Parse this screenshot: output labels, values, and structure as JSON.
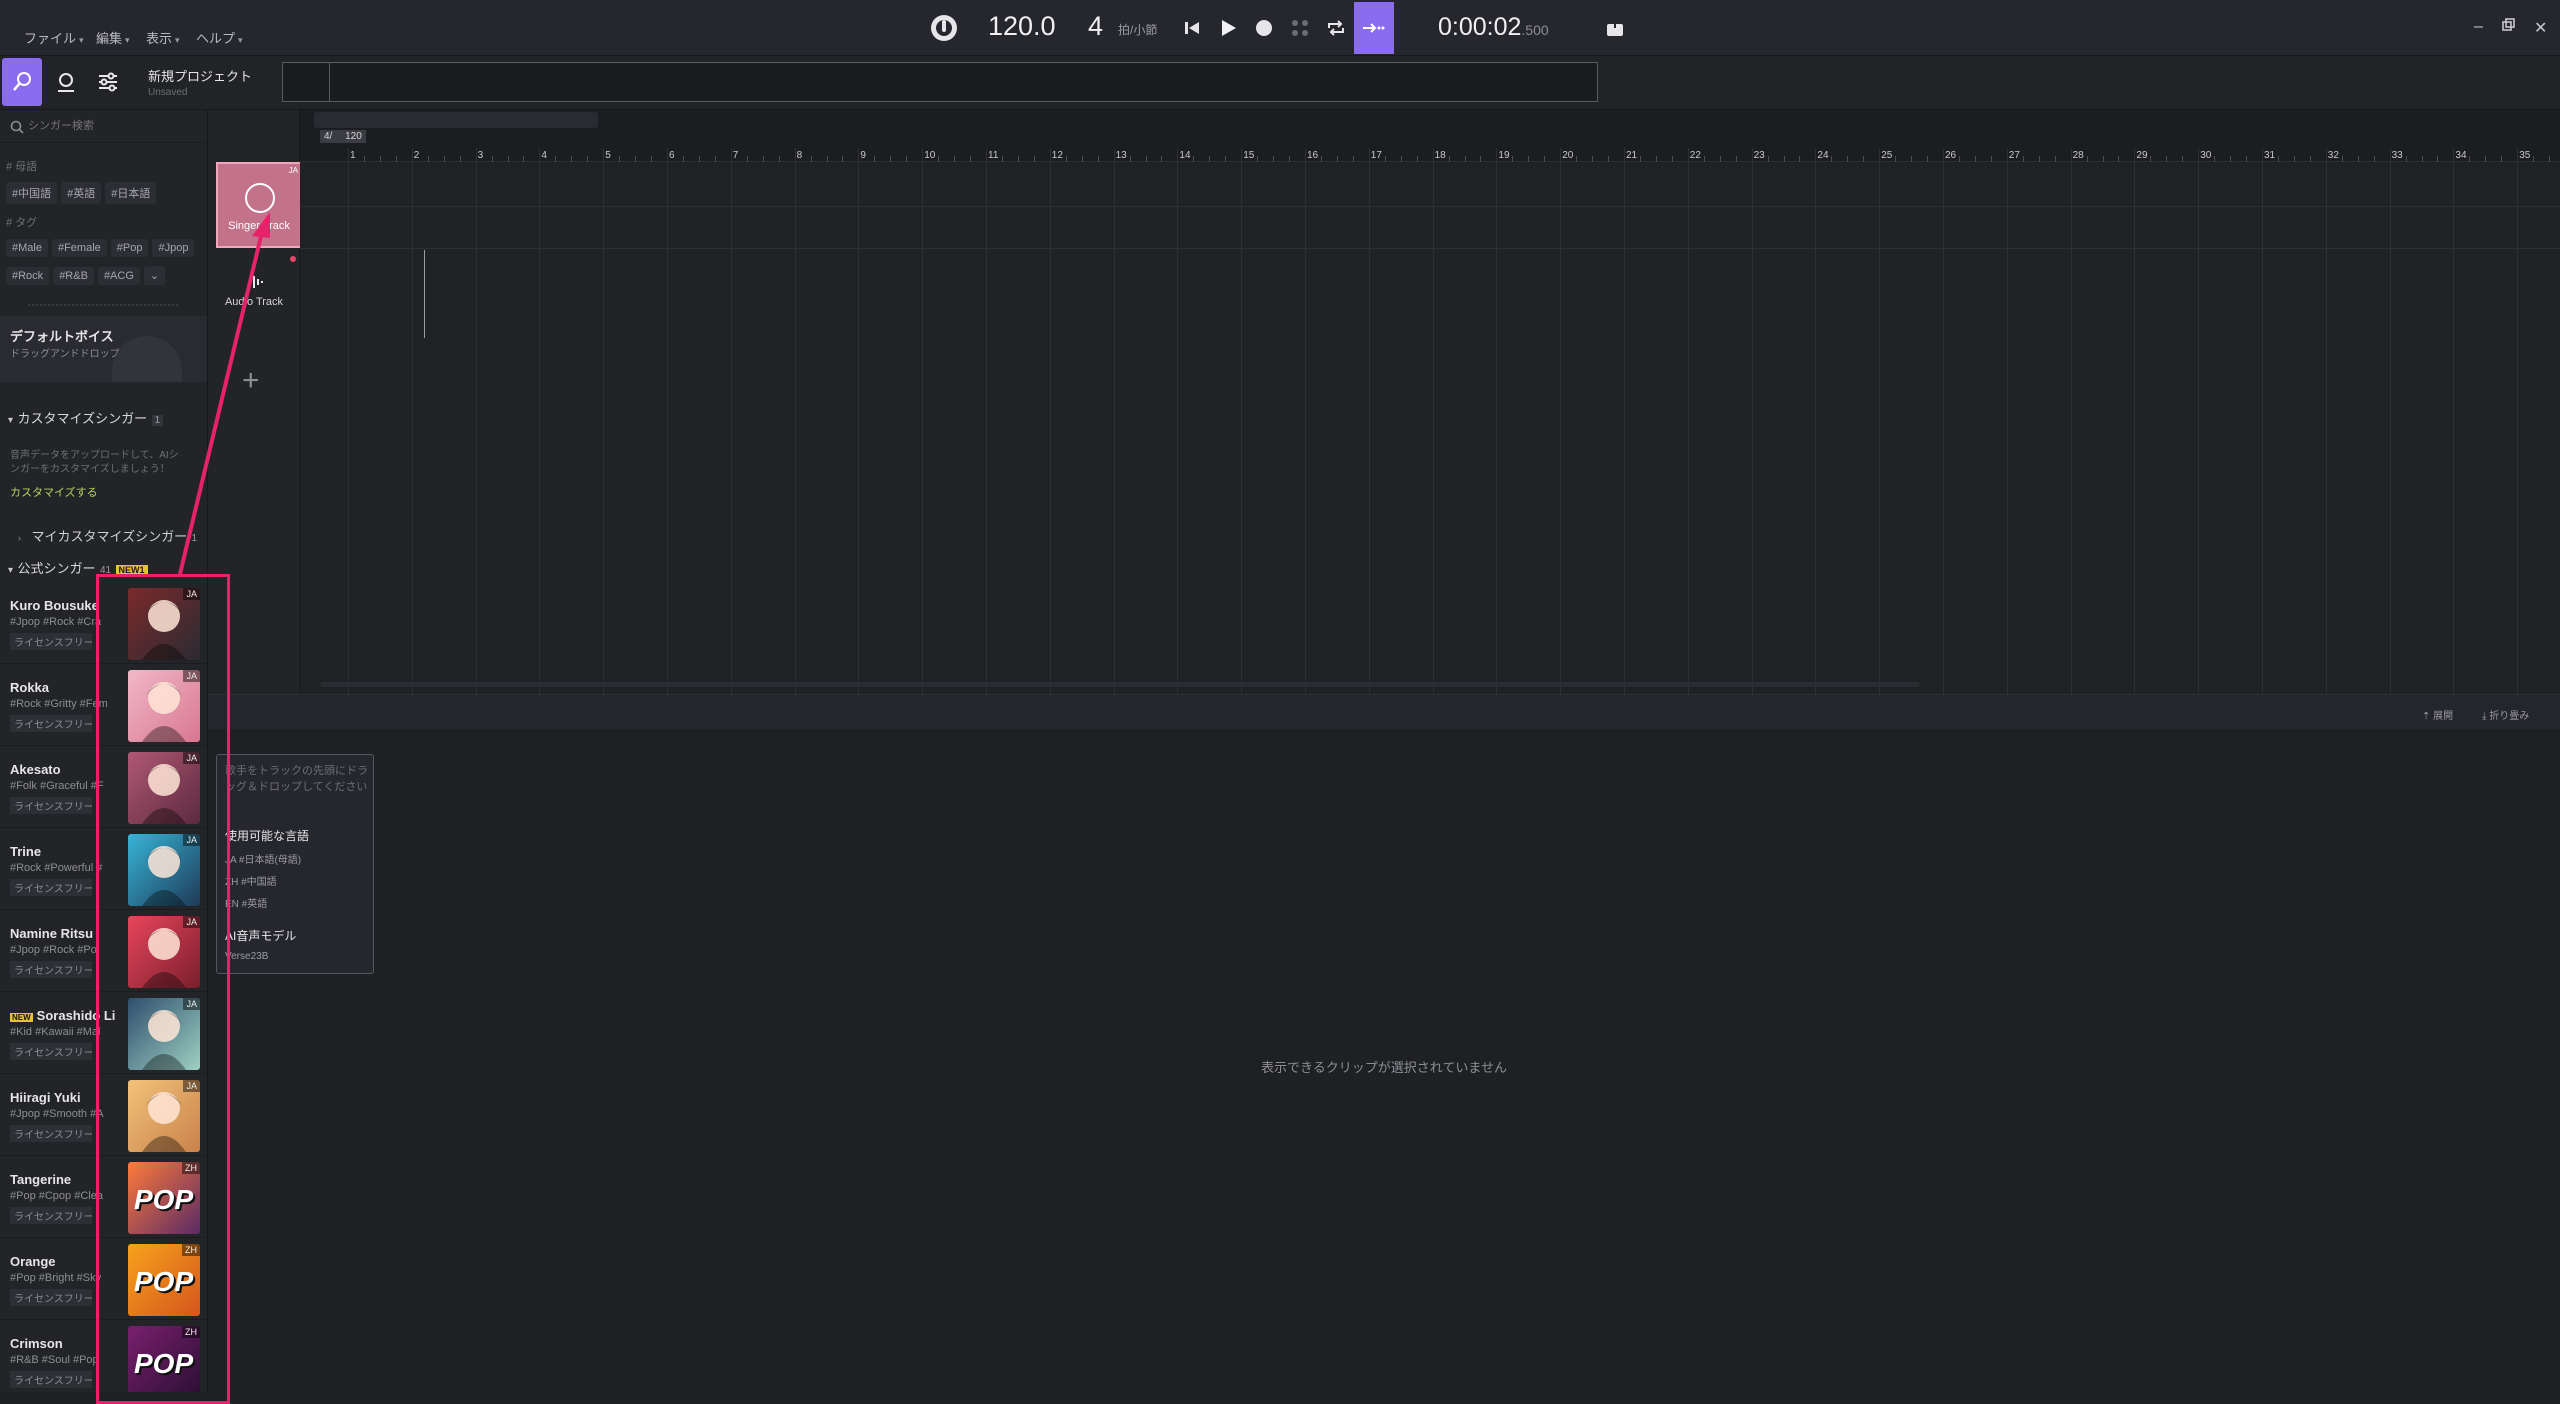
{
  "menu": {
    "file": "ファイル",
    "edit": "編集",
    "view": "表示",
    "help": "ヘルプ"
  },
  "transport": {
    "tempo": "120.0",
    "beats": "4",
    "beats_unit": "拍/小節",
    "time_main": "0:00:02",
    "time_ms": ".500"
  },
  "project": {
    "title": "新規プロジェクト",
    "status": "Unsaved"
  },
  "sidebar": {
    "search_placeholder": "シンガー検索",
    "lang_header": "# 母語",
    "lang_tags": [
      "#中国語",
      "#英語",
      "#日本語"
    ],
    "tag_header": "# タグ",
    "tags_row1": [
      "#Male",
      "#Female",
      "#Pop",
      "#Jpop"
    ],
    "tags_row2": [
      "#Rock",
      "#R&B",
      "#ACG"
    ],
    "default_voice_title": "デフォルトボイス",
    "default_voice_desc": "ドラッグアンドドロップでボイスを",
    "custom_header": "カスタマイズシンガー",
    "custom_count": "1",
    "custom_desc_1": "音声データをアップロードして、AIシ",
    "custom_desc_2": "ンガーをカスタマイズしましょう！",
    "custom_link": "カスタマイズする",
    "my_custom": "マイカスタマイズシンガー",
    "my_custom_count": "1",
    "official_header": "公式シンガー",
    "official_count": "41",
    "new_badge": "NEW1",
    "singers": [
      {
        "name": "Kuro Bousuke",
        "tags": "#Jpop #Rock #Cra",
        "license": "ライセンスフリー",
        "lang": "JA",
        "new": false,
        "color1": "#7a2a2a",
        "color2": "#2b2b33"
      },
      {
        "name": "Rokka",
        "tags": "#Rock #Gritty #Fem",
        "license": "ライセンスフリー",
        "lang": "JA",
        "new": false,
        "color1": "#f0b8c8",
        "color2": "#d9778f"
      },
      {
        "name": "Akesato",
        "tags": "#Folk #Graceful #F",
        "license": "ライセンスフリー",
        "lang": "JA",
        "new": false,
        "color1": "#b05874",
        "color2": "#5b2a3e"
      },
      {
        "name": "Trine",
        "tags": "#Rock #Powerful #",
        "license": "ライセンスフリー",
        "lang": "JA",
        "new": false,
        "color1": "#37b5d8",
        "color2": "#1e3a57"
      },
      {
        "name": "Namine Ritsu",
        "tags": "#Jpop #Rock #Po",
        "license": "ライセンスフリー",
        "lang": "JA",
        "new": false,
        "color1": "#e8455c",
        "color2": "#7a1f2c"
      },
      {
        "name": "Sorashido Li",
        "tags": "#Kid #Kawaii #Mal",
        "license": "ライセンスフリー",
        "lang": "JA",
        "new": true,
        "new_label": "NEW",
        "color1": "#2e4f6e",
        "color2": "#9fd0c2"
      },
      {
        "name": "Hiiragi Yuki",
        "tags": "#Jpop #Smooth #A",
        "license": "ライセンスフリー",
        "lang": "JA",
        "new": false,
        "color1": "#f2c27a",
        "color2": "#c9824a"
      },
      {
        "name": "Tangerine",
        "tags": "#Pop #Cpop #Clea",
        "license": "ライセンスフリー",
        "lang": "ZH",
        "new": false,
        "color1": "#ff7a3a",
        "color2": "#5a2a66",
        "pop": "POP"
      },
      {
        "name": "Orange",
        "tags": "#Pop #Bright #Sky",
        "license": "ライセンスフリー",
        "lang": "ZH",
        "new": false,
        "color1": "#f7a21b",
        "color2": "#d4561c",
        "pop": "POP"
      },
      {
        "name": "Crimson",
        "tags": "#R&B #Soul #Pop",
        "license": "ライセンスフリー",
        "lang": "ZH",
        "new": false,
        "color1": "#7a1f6e",
        "color2": "#2a0f33",
        "pop": "POP"
      }
    ]
  },
  "tracks": {
    "singer_track": "Singer Track",
    "singer_track_badge": "JA",
    "audio_track": "Audio Track"
  },
  "ruler": {
    "signature": "4/",
    "tempo": "120",
    "bars": [
      "1",
      "2",
      "3",
      "4",
      "5",
      "6",
      "7",
      "8",
      "9",
      "10",
      "11",
      "12",
      "13",
      "14",
      "15",
      "16",
      "17",
      "18",
      "19",
      "20",
      "21",
      "22",
      "23",
      "24",
      "25",
      "26",
      "27",
      "28",
      "29",
      "30",
      "31",
      "32",
      "33",
      "34",
      "35"
    ]
  },
  "editor": {
    "expand": "展開",
    "collapse": "折り畳み",
    "empty_message": "表示できるクリップが選択されていません"
  },
  "tooltip": {
    "hint": "歌手をトラックの先頭にドラッグ＆ドロップしてください",
    "lang_title": "使用可能な言語",
    "langs": [
      "JA #日本語(母語)",
      "ZH #中国語",
      "EN #英語"
    ],
    "model_title": "AI音声モデル",
    "model": "Verse23B"
  },
  "colors": {
    "accent": "#8a6cf0",
    "highlight": "#e8226a",
    "link": "#b6d25e"
  }
}
